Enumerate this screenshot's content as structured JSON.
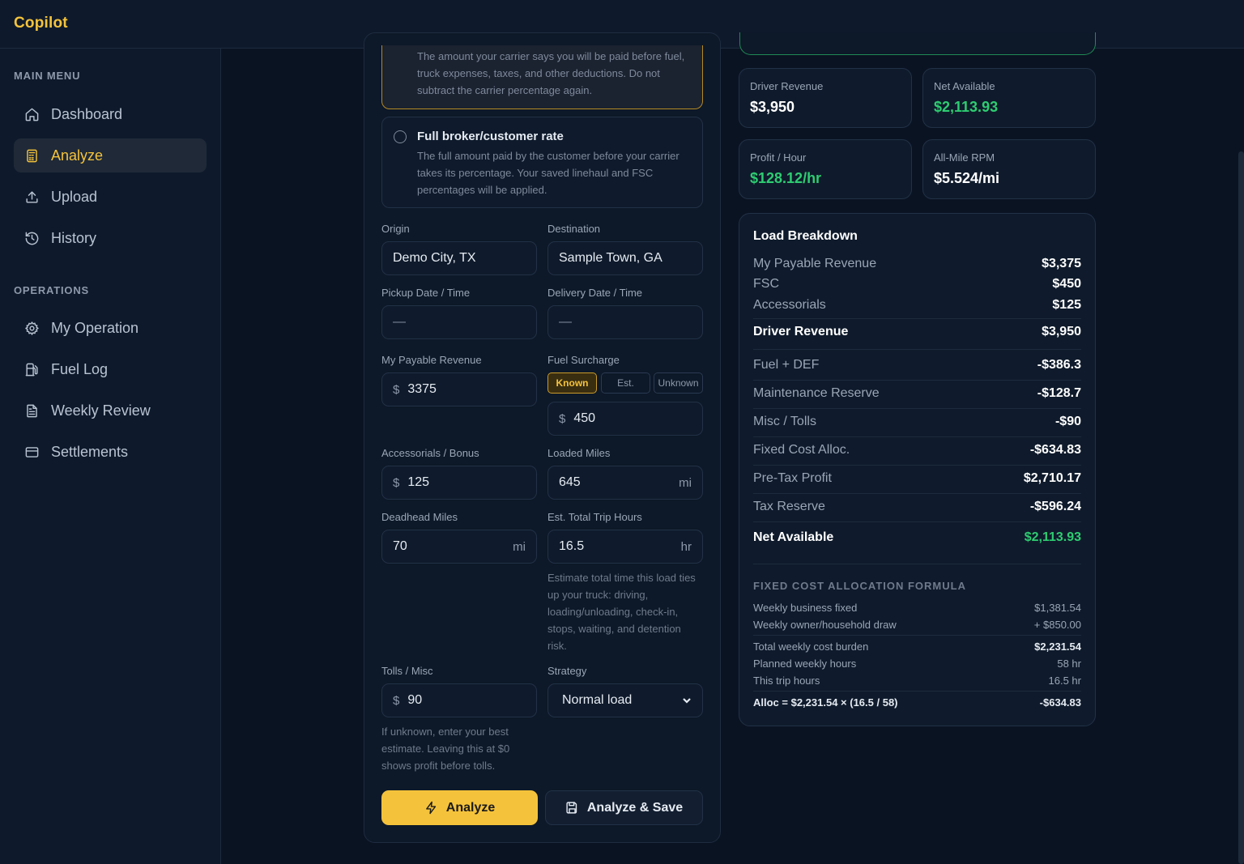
{
  "app": {
    "brand": "Copilot"
  },
  "sidebar": {
    "main_menu_label": "MAIN MENU",
    "operations_label": "OPERATIONS",
    "main_items": [
      {
        "label": "Dashboard",
        "icon": "home-icon"
      },
      {
        "label": "Analyze",
        "icon": "calculator-icon",
        "active": true
      },
      {
        "label": "Upload",
        "icon": "upload-icon"
      },
      {
        "label": "History",
        "icon": "history-icon"
      }
    ],
    "ops_items": [
      {
        "label": "My Operation",
        "icon": "gear-icon"
      },
      {
        "label": "Fuel Log",
        "icon": "fuel-icon"
      },
      {
        "label": "Weekly Review",
        "icon": "document-icon"
      },
      {
        "label": "Settlements",
        "icon": "card-icon"
      }
    ]
  },
  "form": {
    "option_selected_text": "The amount your carrier says you will be paid before fuel, truck expenses, taxes, and other deductions. Do not subtract the carrier percentage again.",
    "option_full_title": "Full broker/customer rate",
    "option_full_text": "The full amount paid by the customer before your carrier takes its percentage. Your saved linehaul and FSC percentages will be applied.",
    "origin": {
      "label": "Origin",
      "value": "Demo City, TX"
    },
    "destination": {
      "label": "Destination",
      "value": "Sample Town, GA"
    },
    "pickup": {
      "label": "Pickup Date / Time",
      "value": "—"
    },
    "delivery": {
      "label": "Delivery Date / Time",
      "value": "—"
    },
    "payable": {
      "label": "My Payable Revenue",
      "prefix": "$",
      "value": "3375"
    },
    "fsc": {
      "label": "Fuel Surcharge",
      "prefix": "$",
      "value": "450",
      "modes": [
        "Known",
        "Est.",
        "Unknown"
      ],
      "active_mode": "Known"
    },
    "accessorials": {
      "label": "Accessorials / Bonus",
      "prefix": "$",
      "value": "125"
    },
    "loaded_miles": {
      "label": "Loaded Miles",
      "value": "645",
      "suffix": "mi"
    },
    "deadhead": {
      "label": "Deadhead Miles",
      "value": "70",
      "suffix": "mi"
    },
    "trip_hours": {
      "label": "Est. Total Trip Hours",
      "value": "16.5",
      "suffix": "hr",
      "help": "Estimate total time this load ties up your truck: driving, loading/unloading, check-in, stops, waiting, and detention risk."
    },
    "tolls": {
      "label": "Tolls / Misc",
      "prefix": "$",
      "value": "90",
      "help": "If unknown, enter your best estimate. Leaving this at $0 shows profit before tolls."
    },
    "strategy": {
      "label": "Strategy",
      "value": "Normal load"
    },
    "analyze_label": "Analyze",
    "analyze_save_label": "Analyze & Save"
  },
  "stats": {
    "driver_revenue": {
      "label": "Driver Revenue",
      "value": "$3,950"
    },
    "net_available": {
      "label": "Net Available",
      "value": "$2,113.93"
    },
    "profit_hour": {
      "label": "Profit / Hour",
      "value": "$128.12/hr"
    },
    "rpm": {
      "label": "All-Mile RPM",
      "value": "$5.524/mi"
    }
  },
  "breakdown": {
    "title": "Load Breakdown",
    "rows": [
      {
        "k": "My Payable Revenue",
        "v": "$3,375"
      },
      {
        "k": "FSC",
        "v": "$450"
      },
      {
        "k": "Accessorials",
        "v": "$125"
      },
      {
        "k": "Driver Revenue",
        "v": "$3,950"
      },
      {
        "k": "Fuel + DEF",
        "v": "-$386.3"
      },
      {
        "k": "Maintenance Reserve",
        "v": "-$128.7"
      },
      {
        "k": "Misc / Tolls",
        "v": "-$90"
      },
      {
        "k": "Fixed Cost Alloc.",
        "v": "-$634.83"
      },
      {
        "k": "Pre-Tax Profit",
        "v": "$2,710.17"
      },
      {
        "k": "Tax Reserve",
        "v": "-$596.24"
      },
      {
        "k": "Net Available",
        "v": "$2,113.93"
      }
    ],
    "formula_title": "FIXED COST ALLOCATION FORMULA",
    "formula": [
      {
        "k": "Weekly business fixed",
        "v": "$1,381.54"
      },
      {
        "k": "Weekly owner/household draw",
        "v": "+ $850.00"
      },
      {
        "k": "Total weekly cost burden",
        "v": "$2,231.54"
      },
      {
        "k": "Planned weekly hours",
        "v": "58 hr"
      },
      {
        "k": "This trip hours",
        "v": "16.5 hr"
      },
      {
        "k": "Alloc = $2,231.54 × (16.5 / 58)",
        "v": "-$634.83"
      }
    ]
  },
  "colors": {
    "accent": "#f5c33b",
    "positive": "#2ecc71",
    "background": "#0a1322"
  }
}
